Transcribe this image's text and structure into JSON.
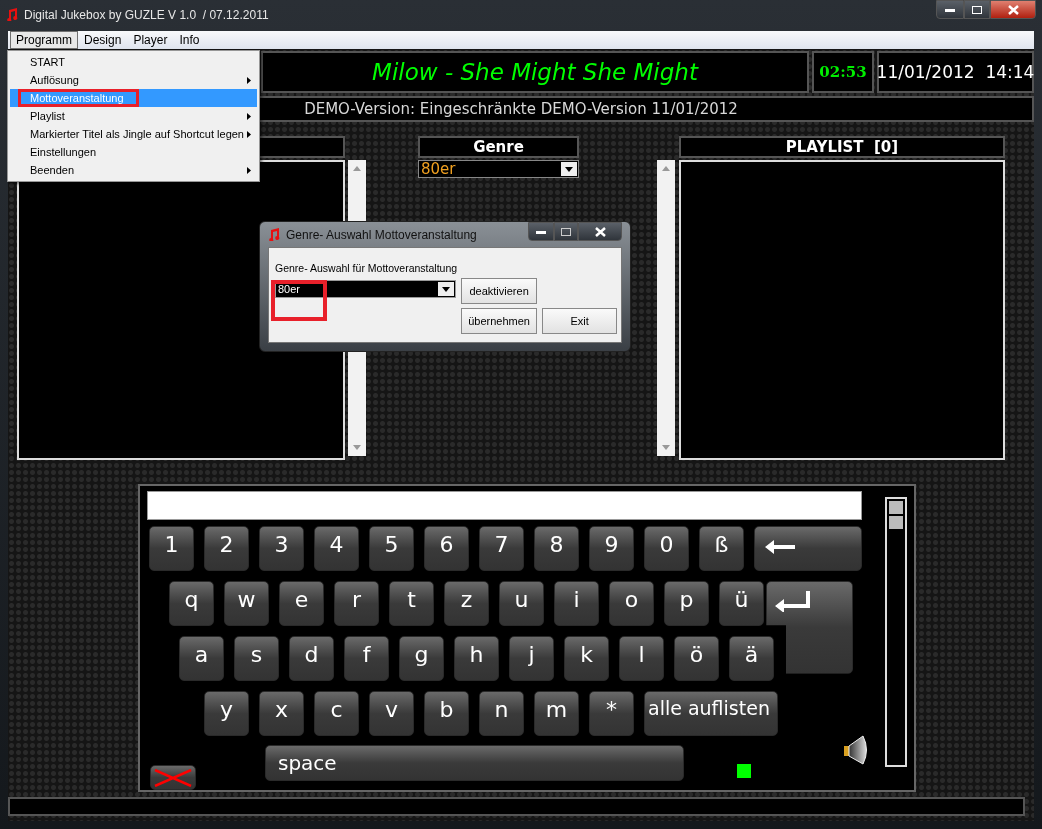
{
  "window": {
    "title": "Digital Jukebox by GUZLE V 1.0  / 07.12.2011"
  },
  "menu": [
    {
      "label": "Programm",
      "selected": true
    },
    {
      "label": "Design",
      "selected": false
    },
    {
      "label": "Player",
      "selected": false
    },
    {
      "label": "Info",
      "selected": false
    }
  ],
  "dropdown": [
    {
      "label": "START",
      "submenu": false,
      "selected": false,
      "marked": false
    },
    {
      "label": "Auflösung",
      "submenu": true,
      "selected": false,
      "marked": false
    },
    {
      "label": "Mottoveranstaltung",
      "submenu": false,
      "selected": true,
      "marked": true
    },
    {
      "label": "Playlist",
      "submenu": true,
      "selected": false,
      "marked": false
    },
    {
      "label": "Markierter Titel als Jingle auf Shortcut legen",
      "submenu": true,
      "selected": false,
      "marked": false
    },
    {
      "label": "Einstellungen",
      "submenu": false,
      "selected": false,
      "marked": false
    },
    {
      "label": "Beenden",
      "submenu": true,
      "selected": false,
      "marked": false
    }
  ],
  "now_playing": "Milow - She Might She Might",
  "elapsed": "02:53",
  "date_time": "11/01/2012  14:14",
  "demo_notice": "DEMO-Version: Eingeschränkte DEMO-Version 11/01/2012",
  "genre": {
    "header": "Genre",
    "value": "80er"
  },
  "playlist": {
    "header": "PLAYLIST  [0]"
  },
  "dialog": {
    "title": "Genre- Auswahl Mottoveranstaltung",
    "label": "Genre- Auswahl für Mottoveranstaltung",
    "value": "80er",
    "value_marked": true,
    "buttons": [
      "deaktivieren",
      "übernehmen",
      "Exit"
    ]
  },
  "keyboard": {
    "rows": [
      [
        "1",
        "2",
        "3",
        "4",
        "5",
        "6",
        "7",
        "8",
        "9",
        "0",
        "ß"
      ],
      [
        "q",
        "w",
        "e",
        "r",
        "t",
        "z",
        "u",
        "i",
        "o",
        "p",
        "ü"
      ],
      [
        "a",
        "s",
        "d",
        "f",
        "g",
        "h",
        "j",
        "k",
        "l",
        "ö",
        "ä"
      ],
      [
        "y",
        "x",
        "c",
        "v",
        "b",
        "n",
        "m",
        "*"
      ]
    ],
    "list_all": "alle auflisten",
    "space": "space"
  }
}
